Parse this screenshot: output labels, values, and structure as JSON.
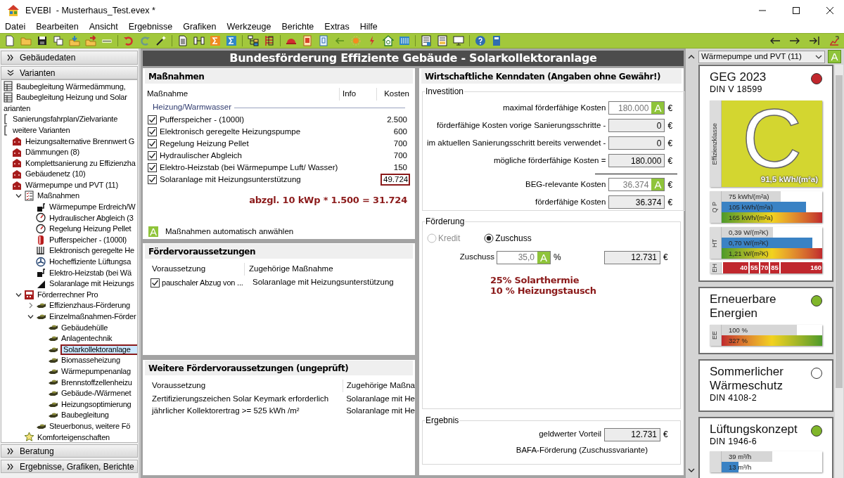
{
  "window": {
    "title": "EVEBI  - Musterhaus_Test.evex *"
  },
  "menu": [
    "Datei",
    "Bearbeiten",
    "Ansicht",
    "Ergebnisse",
    "Grafiken",
    "Werkzeuge",
    "Berichte",
    "Extras",
    "Hilfe"
  ],
  "left_panel": {
    "sections": [
      {
        "label": "Gebäudedaten",
        "expanded": false
      },
      {
        "label": "Varianten",
        "expanded": true
      }
    ],
    "tree": [
      {
        "label": "Baubegleitung Wärmedämmung,",
        "kind": "sheet",
        "selected": false
      },
      {
        "label": "Baubegleitung Heizung und Solar",
        "kind": "sheet",
        "selected": false
      },
      {
        "label": "arianten",
        "selected": false
      },
      {
        "label": "Sanierungsfahrplan/Zielvariante",
        "kind": "bracket",
        "selected": false
      },
      {
        "label": "weitere Varianten",
        "kind": "bracket",
        "selected": false,
        "children": [
          {
            "label": "Heizungsalternative Brennwert G",
            "kind": "house",
            "selected": false
          },
          {
            "label": "Dämmungen (8)",
            "kind": "house",
            "selected": false
          },
          {
            "label": "Komplettsanierung zu Effizienzha",
            "kind": "house",
            "selected": false
          },
          {
            "label": "Gebäudenetz (10)",
            "kind": "house",
            "selected": false
          },
          {
            "label": "Wärmepumpe und PVT (11)",
            "kind": "house",
            "selected": false,
            "children": [
              {
                "label": "Maßnahmen",
                "kind": "checklist",
                "expanded": true,
                "selected": false,
                "children": [
                  {
                    "label": "Wärmepumpe Erdreich/W",
                    "kind": "pump",
                    "selected": false
                  },
                  {
                    "label": "Hydraulischer Abgleich (3",
                    "kind": "gauge",
                    "selected": false
                  },
                  {
                    "label": "Regelung Heizung Pellet",
                    "kind": "gauge",
                    "selected": false
                  },
                  {
                    "label": "Pufferspeicher - (1000l)",
                    "kind": "tank",
                    "selected": false
                  },
                  {
                    "label": "Elektronisch geregelte He",
                    "kind": "radiator",
                    "selected": false
                  },
                  {
                    "label": "Hocheffiziente Lüftungsa",
                    "kind": "fan",
                    "selected": false
                  },
                  {
                    "label": "Elektro-Heizstab (bei Wä",
                    "kind": "pump",
                    "selected": false
                  },
                  {
                    "label": "Solaranlage mit Heizungs",
                    "kind": "solar",
                    "selected": false
                  }
                ]
              },
              {
                "label": "Förderrechner Pro",
                "kind": "calculator",
                "expanded": true,
                "selected": false,
                "children": [
                  {
                    "label": "Effizienzhaus-Förderung",
                    "kind": "hand",
                    "expanded": false,
                    "selected": false
                  },
                  {
                    "label": "Einzelmaßnahmen-Förder",
                    "kind": "hand",
                    "expanded": true,
                    "selected": false,
                    "children": [
                      {
                        "label": "Gebäudehülle",
                        "kind": "hand",
                        "selected": false
                      },
                      {
                        "label": "Anlagentechnik",
                        "kind": "hand",
                        "selected": false
                      },
                      {
                        "label": "Solarkollektoranlage",
                        "kind": "hand",
                        "selected": true
                      },
                      {
                        "label": "Biomasseheizung",
                        "kind": "hand",
                        "selected": false
                      },
                      {
                        "label": "Wärmepumpenanlag",
                        "kind": "hand",
                        "selected": false
                      },
                      {
                        "label": "Brennstoffzellenheizu",
                        "kind": "hand",
                        "selected": false
                      },
                      {
                        "label": "Gebäude-/Wärmenet",
                        "kind": "hand",
                        "selected": false
                      },
                      {
                        "label": "Heizungsoptimierung",
                        "kind": "hand",
                        "selected": false
                      },
                      {
                        "label": "Baubegleitung",
                        "kind": "hand",
                        "selected": false
                      }
                    ]
                  },
                  {
                    "label": "Steuerbonus, weitere Fö",
                    "kind": "hand",
                    "selected": false
                  }
                ]
              },
              {
                "label": "Komforteigenschaften",
                "kind": "star",
                "selected": false
              }
            ]
          }
        ]
      }
    ],
    "bottom_sections": [
      {
        "label": "Beratung",
        "expanded": false
      },
      {
        "label": "Ergebnisse, Grafiken, Berichte",
        "expanded": false
      }
    ]
  },
  "page_title": "Bundesförderung Effiziente Gebäude - Solarkollektoranlage",
  "measures": {
    "title": "Maßnahmen",
    "columns": [
      "Maßnahme",
      "Info",
      "Kosten"
    ],
    "group": "Heizung/Warmwasser",
    "rows": [
      {
        "label": "Pufferspeicher - (1000l)",
        "checked": true,
        "cost": "2.500",
        "highlighted": false
      },
      {
        "label": "Elektronisch geregelte Heizungspumpe",
        "checked": true,
        "cost": "600",
        "highlighted": false
      },
      {
        "label": "Regelung Heizung Pellet",
        "checked": true,
        "cost": "700",
        "highlighted": false
      },
      {
        "label": "Hydraulischer Abgleich",
        "checked": true,
        "cost": "700",
        "highlighted": false
      },
      {
        "label": "Elektro-Heizstab (bei Wärmepumpe Luft/ Wasser)",
        "checked": true,
        "cost": "150",
        "highlighted": false
      },
      {
        "label": "Solaranlage mit Heizungsunterstützung",
        "checked": true,
        "cost": "49.724",
        "highlighted": true
      }
    ],
    "note": "abzgl. 10 kWp * 1.500 = 31.724",
    "auto_button": "A",
    "auto_label": "Maßnahmen automatisch anwählen"
  },
  "requirements": {
    "title": "Fördervoraussetzungen",
    "columns": [
      "Voraussetzung",
      "Zugehörige Maßnahme"
    ],
    "rows": [
      {
        "checked": true,
        "requirement": "pauschaler Abzug von ...",
        "measure": "Solaranlage mit Heizungsunterstützung"
      }
    ]
  },
  "further_requirements": {
    "title": "Weitere Fördervoraussetzungen (ungeprüft)",
    "columns": [
      "Voraussetzung",
      "Zugehörige Maßna"
    ],
    "rows": [
      {
        "requirement": "Zertifizierungszeichen Solar Keymark erforderlich",
        "measure": "Solaranlage mit He"
      },
      {
        "requirement": "jährlicher Kollektorertrag >= 525 kWh /m²",
        "measure": "Solaranlage mit He"
      }
    ]
  },
  "economics": {
    "title": "Wirtschaftliche Kenndaten (Angaben ohne Gewähr!)",
    "investment": {
      "legend": "Investition",
      "rows": [
        {
          "label": "maximal förderfähige Kosten",
          "value": "180.000",
          "editable": true,
          "auto": "A",
          "unit": "€"
        },
        {
          "label": "förderfähige Kosten vorige Sanierungsschritte -",
          "value": "0",
          "editable": false,
          "unit": "€"
        },
        {
          "label": "im aktuellen Sanierungsschritt bereits verwendet -",
          "value": "0",
          "editable": false,
          "unit": "€"
        },
        {
          "label": "mögliche förderfähige Kosten =",
          "value": "180.000",
          "editable": false,
          "unit": "€"
        },
        {
          "label": "BEG-relevante Kosten",
          "value": "36.374",
          "editable": true,
          "auto": "A",
          "unit": "€",
          "rule_above": true
        },
        {
          "label": "förderfähige Kosten",
          "value": "36.374",
          "editable": false,
          "unit": "€"
        }
      ]
    },
    "funding": {
      "legend": "Förderung",
      "options": [
        {
          "label": "Kredit",
          "selected": false,
          "disabled": true
        },
        {
          "label": "Zuschuss",
          "selected": true,
          "disabled": false
        }
      ],
      "rate": {
        "label": "Zuschuss",
        "value": "35,0",
        "auto": "A",
        "unit": "%"
      },
      "amount": {
        "value": "12.731",
        "unit": "€"
      },
      "notes": [
        "25% Solarthermie",
        "10 % Heizungstausch"
      ]
    },
    "result": {
      "legend": "Ergebnis",
      "label": "geldwerter Vorteil",
      "value": "12.731",
      "unit": "€",
      "caption": "BAFA-Förderung (Zuschussvariante)"
    }
  },
  "variant_select": {
    "value": "Wärmepumpe und PVT (11)",
    "auto": "A"
  },
  "cards": [
    {
      "title": "GEG 2023",
      "subtitle": "DIN V 18599",
      "color": "#c1272d",
      "class_label": "Effizienzklasse",
      "class_letter": "C",
      "class_value": "91,5 kWh/(m²a)",
      "groups": [
        {
          "label": "Q P",
          "bars": [
            {
              "text": "75 kWh/(m²a)",
              "kind": "reference",
              "level": 0.59
            },
            {
              "text": "105 kWh/(m²a)",
              "kind": "actual",
              "level": 0.84
            },
            {
              "text": "165 kWh/(m²a)",
              "kind": "scale",
              "level": 1
            }
          ]
        },
        {
          "label": "HT",
          "bars": [
            {
              "text": "0,39 W/(m²K)",
              "kind": "reference",
              "level": 0.51
            },
            {
              "text": "0,70 W/(m²K)",
              "kind": "actual",
              "level": 0.9
            },
            {
              "text": "1,21 W/(m²K)",
              "kind": "scale",
              "level": 1
            }
          ]
        }
      ],
      "eh_scale": {
        "label": "EH",
        "steps": [
          "40",
          "55",
          "70",
          "85",
          "160"
        ]
      }
    },
    {
      "title": "Erneuerbare Energien",
      "color": "#80b62a",
      "groups": [
        {
          "label": "EE",
          "bars": [
            {
              "text": "100 %",
              "kind": "reference",
              "level": 0.75
            },
            {
              "text": "327 %",
              "kind": "scale_reverse",
              "level": 1
            }
          ]
        }
      ]
    },
    {
      "title": "Sommerlicher Wärmeschutz",
      "subtitle": "DIN 4108-2",
      "color": "#ffffff"
    },
    {
      "title": "Lüftungskonzept",
      "subtitle": "DIN 1946-6",
      "color": "#80b62a",
      "groups": [
        {
          "bars": [
            {
              "text": "39 m³/h",
              "kind": "reference",
              "level": 0.5
            },
            {
              "text": "13 m³/h",
              "kind": "actual",
              "level": 0.17
            }
          ]
        }
      ]
    }
  ]
}
